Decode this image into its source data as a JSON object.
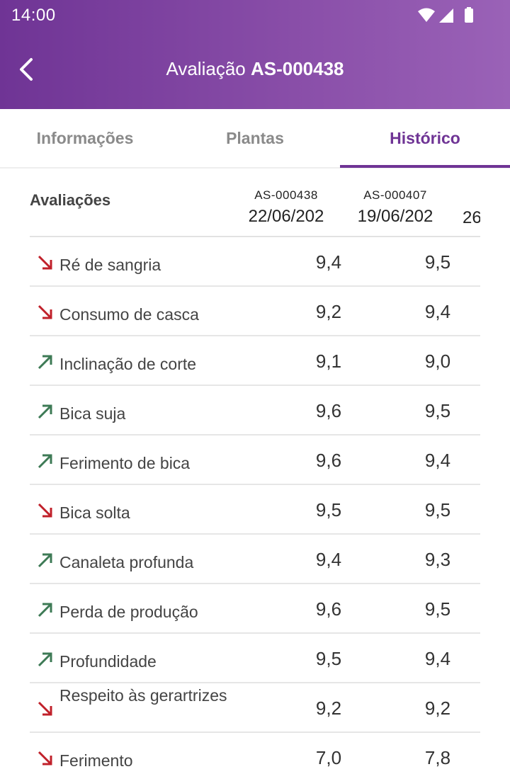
{
  "status_bar": {
    "time": "14:00"
  },
  "header": {
    "title_prefix": "Avaliação",
    "title_code": "AS-000438"
  },
  "tabs": [
    {
      "label": "Informações",
      "active": false
    },
    {
      "label": "Plantas",
      "active": false
    },
    {
      "label": "Histórico",
      "active": true
    }
  ],
  "table": {
    "header_label": "Avaliações",
    "columns": [
      {
        "code": "AS-000438",
        "date": "22/06/202"
      },
      {
        "code": "AS-000407",
        "date": "19/06/202"
      }
    ],
    "partial_column_date": "26",
    "rows": [
      {
        "label": "Ré de sangria",
        "trend": "down",
        "values": [
          "9,4",
          "9,5"
        ]
      },
      {
        "label": "Consumo de casca",
        "trend": "down",
        "values": [
          "9,2",
          "9,4"
        ]
      },
      {
        "label": "Inclinação de corte",
        "trend": "up",
        "values": [
          "9,1",
          "9,0"
        ]
      },
      {
        "label": "Bica suja",
        "trend": "up",
        "values": [
          "9,6",
          "9,5"
        ]
      },
      {
        "label": "Ferimento de bica",
        "trend": "up",
        "values": [
          "9,6",
          "9,4"
        ]
      },
      {
        "label": "Bica solta",
        "trend": "down",
        "values": [
          "9,5",
          "9,5"
        ]
      },
      {
        "label": "Canaleta profunda",
        "trend": "up",
        "values": [
          "9,4",
          "9,3"
        ]
      },
      {
        "label": "Perda de produção",
        "trend": "up",
        "values": [
          "9,6",
          "9,5"
        ]
      },
      {
        "label": "Profundidade",
        "trend": "up",
        "values": [
          "9,5",
          "9,4"
        ]
      },
      {
        "label": "Respeito às gerartrizes",
        "trend": "down",
        "values": [
          "9,2",
          "9,2"
        ]
      },
      {
        "label": "Ferimento",
        "trend": "down",
        "values": [
          "7,0",
          "7,8"
        ]
      }
    ]
  },
  "colors": {
    "brand": "#6f3495",
    "trend_up": "#3d7a55",
    "trend_down": "#c0202a"
  },
  "icons": {
    "back": "arrow-back-icon",
    "wifi": "wifi-icon",
    "signal": "cell-signal-icon",
    "battery": "battery-icon",
    "trend_up": "trend-up-arrow-icon",
    "trend_down": "trend-down-arrow-icon"
  }
}
